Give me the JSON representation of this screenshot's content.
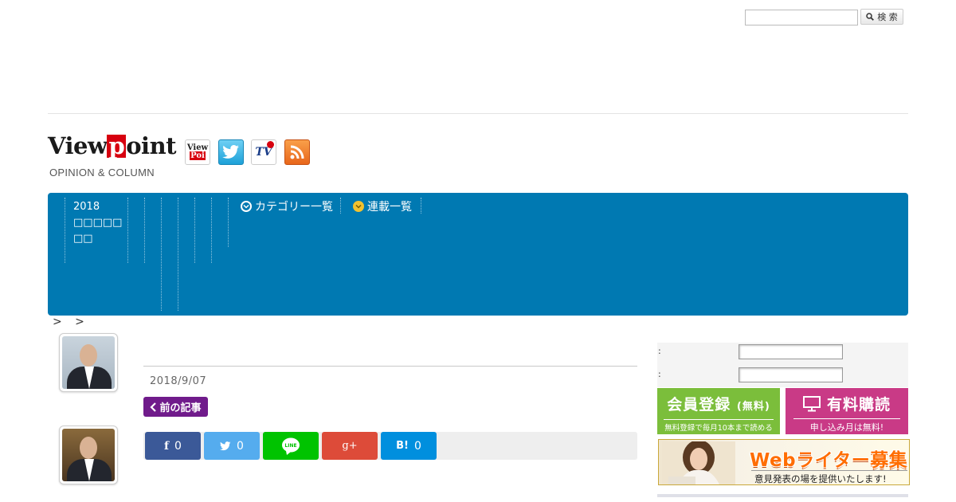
{
  "search": {
    "placeholder": "",
    "value": "",
    "button_label": "検 索"
  },
  "logo": {
    "word_before": "View",
    "word_highlight": "p",
    "word_after": "oint",
    "tagline": "OPINION & COLUMN"
  },
  "social_icons": [
    {
      "name": "viewpoint-facebook-icon",
      "text_top": "View",
      "text_bottom": "Poi"
    },
    {
      "name": "twitter-icon"
    },
    {
      "name": "tv-facebook-icon",
      "text": "TV"
    },
    {
      "name": "rss-icon"
    }
  ],
  "nav": {
    "date_label": "2018\n□□□□□\n□□",
    "items": [
      {
        "label": "カテゴリー一覧",
        "icon": "chevron-circle-white"
      },
      {
        "label": "連載一覧",
        "icon": "chevron-circle-gold"
      }
    ],
    "color": "#0079b2"
  },
  "breadcrumb": {
    "text": "> >"
  },
  "article": {
    "date": "2018/9/07",
    "prev_label": "前の記事"
  },
  "share": [
    {
      "service": "facebook",
      "glyph": "f",
      "count": "0",
      "color": "#3b5998"
    },
    {
      "service": "twitter",
      "glyph": "",
      "count": "0",
      "color": "#55acee"
    },
    {
      "service": "line",
      "glyph": "LINE",
      "count": "",
      "color": "#00c300"
    },
    {
      "service": "google-plus",
      "glyph": "g+",
      "count": "",
      "color": "#dd4b39"
    },
    {
      "service": "hatena",
      "glyph": "B!",
      "count": "0",
      "color": "#008fde"
    }
  ],
  "login": {
    "label_1": ":",
    "label_2": ":"
  },
  "banners": {
    "member": {
      "title": "会員登録",
      "title_small": "(無料)",
      "sub": "無料登録で毎月10本まで読める"
    },
    "paid": {
      "title": "有料購読",
      "sub": "申し込み月は無料!"
    },
    "writer": {
      "title": "Webライター募集",
      "sub": "意見発表の場を提供いたします!"
    }
  }
}
